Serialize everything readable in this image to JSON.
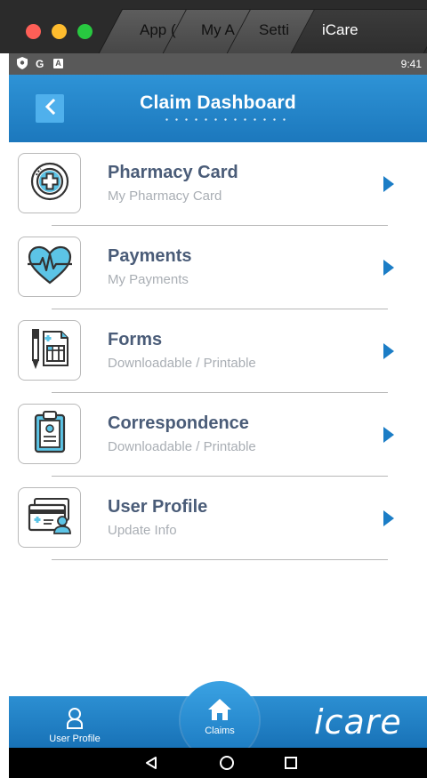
{
  "window": {
    "tabs": [
      {
        "label": "App ("
      },
      {
        "label": "My A"
      },
      {
        "label": "Setti"
      },
      {
        "label": "iCare"
      }
    ]
  },
  "statusbar": {
    "icons": [
      "shield-icon",
      "g-icon",
      "a-icon"
    ],
    "g_text": "G",
    "a_text": "A",
    "time": "9:41"
  },
  "header": {
    "title": "Claim Dashboard",
    "back_icon": "chevron-left-icon"
  },
  "items": [
    {
      "title": "Pharmacy Card",
      "subtitle": "My Pharmacy Card",
      "icon": "medical-cross-icon"
    },
    {
      "title": "Payments",
      "subtitle": "My Payments",
      "icon": "heartbeat-icon"
    },
    {
      "title": "Forms",
      "subtitle": "Downloadable / Printable",
      "icon": "form-pen-icon"
    },
    {
      "title": "Correspondence",
      "subtitle": "Downloadable / Printable",
      "icon": "clipboard-icon"
    },
    {
      "title": "User Profile",
      "subtitle": "Update Info",
      "icon": "id-card-icon"
    }
  ],
  "bottom_nav": {
    "user_profile_label": "User Profile",
    "claims_label": "Claims",
    "brand": "icare"
  },
  "android_nav": [
    "back-triangle-icon",
    "home-circle-icon",
    "recents-square-icon"
  ],
  "colors": {
    "primary_blue": "#1c78bd",
    "title_text": "#4a5c78",
    "subtitle_text": "#a9aeb4",
    "chevron": "#1b7dc6"
  }
}
